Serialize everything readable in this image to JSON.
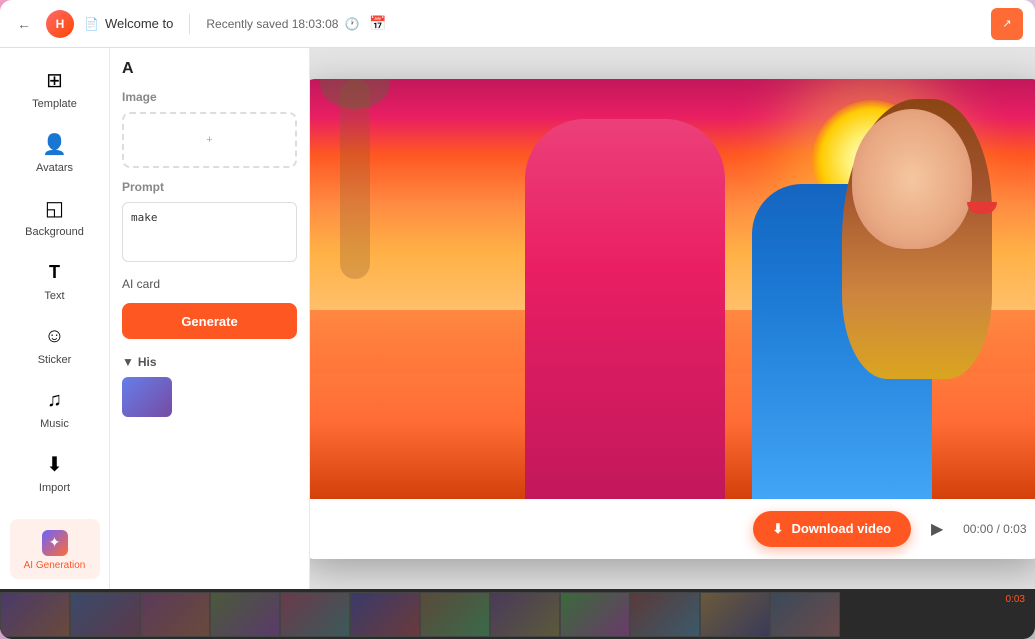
{
  "app": {
    "title": "Welcome to",
    "logo_text": "H",
    "saved_info": "Recently saved 18:03:08",
    "back_icon": "←",
    "share_icon": "↗"
  },
  "sidebar": {
    "items": [
      {
        "id": "template",
        "label": "Template",
        "icon": "⊞",
        "active": false
      },
      {
        "id": "avatars",
        "label": "Avatars",
        "icon": "👤",
        "active": false
      },
      {
        "id": "background",
        "label": "Background",
        "icon": "◱",
        "active": false
      },
      {
        "id": "text",
        "label": "Text",
        "icon": "T",
        "active": false
      },
      {
        "id": "sticker",
        "label": "Sticker",
        "icon": "☺",
        "active": false
      },
      {
        "id": "music",
        "label": "Music",
        "icon": "♪",
        "active": false
      },
      {
        "id": "import",
        "label": "Import",
        "icon": "⬇",
        "active": false
      },
      {
        "id": "ai-generation",
        "label": "AI Generation",
        "icon": "✦",
        "active": true
      }
    ]
  },
  "left_panel": {
    "title": "A",
    "image_label": "Image",
    "prompt_label": "Prompt",
    "prompt_placeholder": "make",
    "ai_card_label": "AI card",
    "generate_label": "Generate",
    "history_label": "His"
  },
  "video_modal": {
    "download_label": "Download video",
    "download_icon": "⬇",
    "play_icon": "▶",
    "time_current": "00:00",
    "time_total": "0:03",
    "time_display": "00:00 / 0:03"
  },
  "timeline": {
    "time_label": "0:03"
  },
  "colors": {
    "accent": "#ff5722",
    "sidebar_bg": "#ffffff",
    "canvas_bg": "#d8d8d8",
    "top_bar_bg": "#ffffff"
  }
}
